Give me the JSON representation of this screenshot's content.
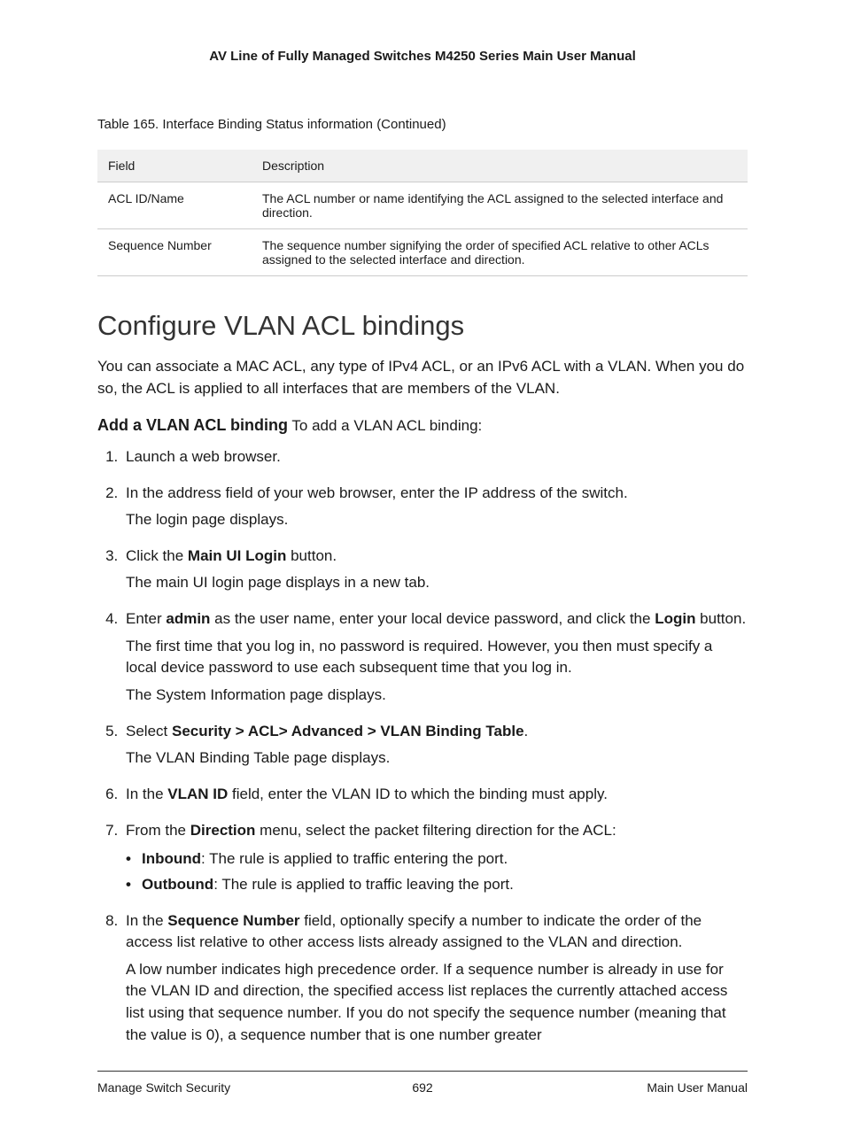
{
  "header": {
    "title": "AV Line of Fully Managed Switches M4250 Series Main User Manual"
  },
  "table": {
    "caption": "Table 165. Interface Binding Status information (Continued)",
    "columns": {
      "field": "Field",
      "description": "Description"
    },
    "rows": [
      {
        "field": "ACL ID/Name",
        "description": "The ACL number or name identifying the ACL assigned to the selected interface and direction."
      },
      {
        "field": "Sequence Number",
        "description": "The sequence number signifying the order of specified ACL relative to other ACLs assigned to the selected interface and direction."
      }
    ]
  },
  "section": {
    "title": "Configure VLAN ACL bindings",
    "intro": "You can associate a MAC ACL, any type of IPv4 ACL, or an IPv6 ACL with a VLAN. When you do so, the ACL is applied to all interfaces that are members of the VLAN.",
    "subheading": "Add a VLAN ACL binding",
    "subheading_tail": " To add a VLAN ACL binding:",
    "steps": {
      "s1": "Launch a web browser.",
      "s2a": "In the address field of your web browser, enter the IP address of the switch.",
      "s2b": "The login page displays.",
      "s3a_pre": "Click the ",
      "s3a_bold": "Main UI Login",
      "s3a_post": " button.",
      "s3b": "The main UI login page displays in a new tab.",
      "s4a_pre": "Enter ",
      "s4a_bold1": "admin",
      "s4a_mid": " as the user name, enter your local device password, and click the ",
      "s4a_bold2": "Login",
      "s4a_post": " button.",
      "s4b": "The first time that you log in, no password is required. However, you then must specify a local device password to use each subsequent time that you log in.",
      "s4c": "The System Information page displays.",
      "s5a_pre": "Select ",
      "s5a_bold": "Security > ACL> Advanced > VLAN Binding Table",
      "s5a_post": ".",
      "s5b": "The VLAN Binding Table page displays.",
      "s6_pre": "In the ",
      "s6_bold": "VLAN ID",
      "s6_post": " field, enter the VLAN ID to which the binding must apply.",
      "s7_pre": "From the ",
      "s7_bold": "Direction",
      "s7_post": " menu, select the packet filtering direction for the ACL:",
      "s7_b1_bold": "Inbound",
      "s7_b1_rest": ": The rule is applied to traffic entering the port.",
      "s7_b2_bold": "Outbound",
      "s7_b2_rest": ": The rule is applied to traffic leaving the port.",
      "s8a_pre": "In the ",
      "s8a_bold": "Sequence Number",
      "s8a_post": " field, optionally specify a number to indicate the order of the access list relative to other access lists already assigned to the VLAN and direction.",
      "s8b": "A low number indicates high precedence order. If a sequence number is already in use for the VLAN ID and direction, the specified access list replaces the currently attached access list using that sequence number. If you do not specify the sequence number (meaning that the value is 0), a sequence number that is one number greater"
    }
  },
  "footer": {
    "left": "Manage Switch Security",
    "center": "692",
    "right": "Main User Manual"
  }
}
